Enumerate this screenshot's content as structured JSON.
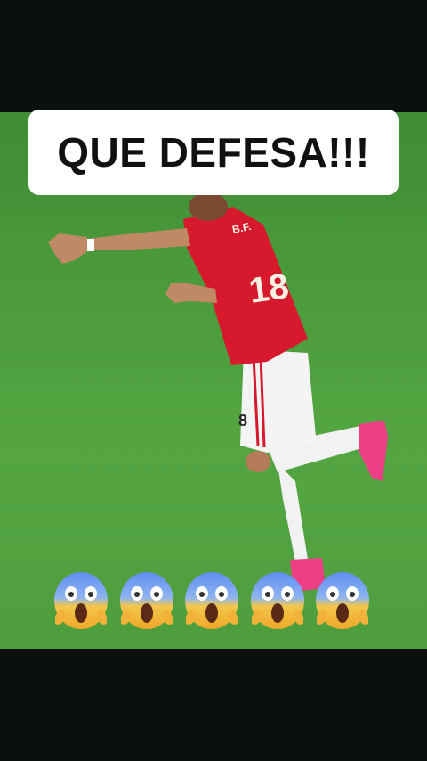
{
  "caption": {
    "text": "QUE DEFESA!!!"
  },
  "player": {
    "number": "18",
    "shirt_color": "#d6192c",
    "shorts_color": "#f4f4f4",
    "boot_color": "#ec3f86"
  },
  "pitch": {
    "color": "#4c9c3c"
  },
  "reactions": {
    "count": 5,
    "icon": "screaming-in-fear-emoji"
  }
}
